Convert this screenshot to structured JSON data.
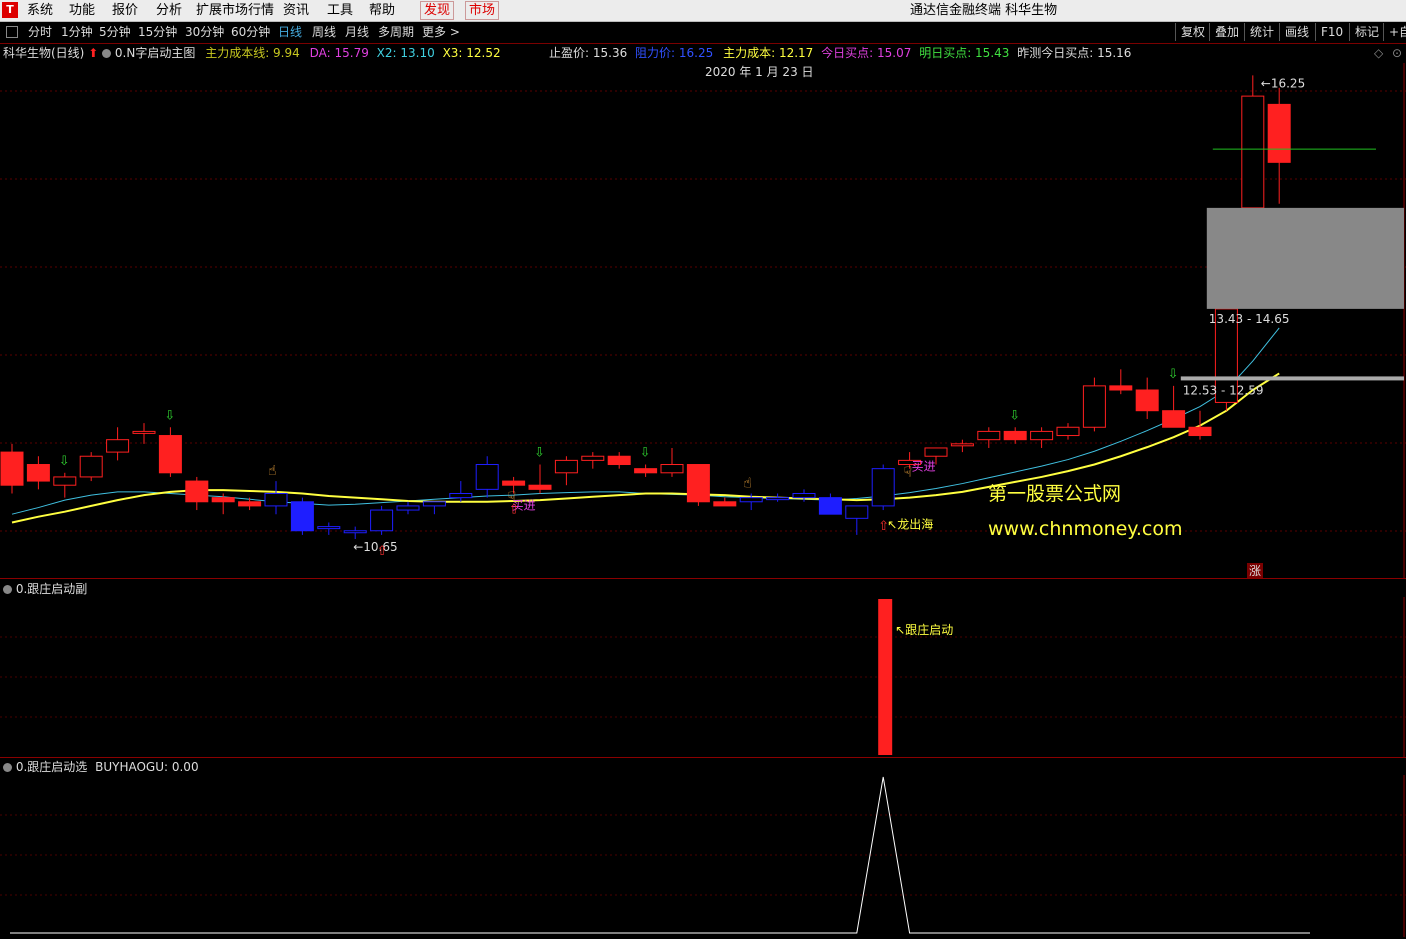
{
  "menubar": {
    "logo": "T",
    "items": [
      "系统",
      "功能",
      "报价",
      "分析",
      "扩展市场行情",
      "资讯",
      "工具",
      "帮助"
    ],
    "discover": "发现",
    "market": "市场",
    "title": "通达信金融终端  科华生物"
  },
  "periodbar": {
    "items": [
      "分时",
      "1分钟",
      "5分钟",
      "15分钟",
      "30分钟",
      "60分钟",
      "日线",
      "周线",
      "月线",
      "多周期",
      "更多 >"
    ],
    "active": "日线",
    "tools": [
      "复权",
      "叠加",
      "统计",
      "画线",
      "F10",
      "标记",
      "+自"
    ]
  },
  "main_pane": {
    "stock": "科华生物(日线)",
    "indicator": "0.N字启动主图",
    "stat1_label": "主力成本线: 9.94",
    "stat2_label": "DA: 15.79",
    "stat3_label": "X2: 13.10",
    "stat4_label": "X3: 12.52",
    "take_profit": "止盈价: 15.36",
    "resistance": "阻力价: 16.25",
    "main_cost": "主力成本: 12.17",
    "today_buy": "今日买点: 15.07",
    "tomorrow_buy": "明日买点: 15.43",
    "yesterday_buy": "昨测今日买点: 15.16",
    "date": "2020 年 1 月 23 日",
    "low_label": "←10.65",
    "high_label": "←16.25",
    "range1": "13.43 - 14.65",
    "range2": "12.53 - 12.59",
    "buy_text": "买进",
    "dragon_text": "↖龙出海",
    "watermark1": "第一股票公式网",
    "watermark2": "www.chnmoney.com",
    "zhang": "涨",
    "colors": {
      "up": "#ff2020",
      "down": "#1e1eff",
      "ma_yellow": "#ffff40",
      "ma_cyan": "#40c0e0",
      "text_yellow": "#ffff40"
    }
  },
  "sub_pane1": {
    "title": "0.跟庄启动副",
    "label": "↖跟庄启动"
  },
  "sub_pane2": {
    "title": "0.跟庄启动选",
    "value_label": "BUYHAOGU: 0.00"
  },
  "chart_data": [
    {
      "type": "candlestick",
      "ohlc": [
        [
          11.7,
          11.8,
          11.2,
          11.3
        ],
        [
          11.55,
          11.65,
          11.25,
          11.35
        ],
        [
          11.3,
          11.45,
          11.15,
          11.4
        ],
        [
          11.4,
          11.7,
          11.35,
          11.65
        ],
        [
          11.7,
          12.0,
          11.6,
          11.85
        ],
        [
          11.95,
          12.05,
          11.8,
          11.95
        ],
        [
          11.9,
          12.0,
          11.4,
          11.45
        ],
        [
          11.35,
          11.4,
          11.0,
          11.1
        ],
        [
          11.15,
          11.2,
          10.95,
          11.1
        ],
        [
          11.1,
          11.15,
          11.0,
          11.05
        ],
        [
          11.05,
          11.35,
          10.95,
          11.2
        ],
        [
          11.1,
          11.15,
          10.7,
          10.75
        ],
        [
          10.8,
          10.85,
          10.7,
          10.8
        ],
        [
          10.75,
          10.8,
          10.65,
          10.75
        ],
        [
          10.75,
          11.05,
          10.7,
          11.0
        ],
        [
          11.0,
          11.1,
          10.95,
          11.05
        ],
        [
          11.05,
          11.1,
          10.95,
          11.1
        ],
        [
          11.15,
          11.35,
          11.1,
          11.2
        ],
        [
          11.25,
          11.65,
          11.15,
          11.55
        ],
        [
          11.35,
          11.4,
          11.2,
          11.3
        ],
        [
          11.3,
          11.55,
          11.2,
          11.25
        ],
        [
          11.45,
          11.65,
          11.3,
          11.6
        ],
        [
          11.6,
          11.7,
          11.5,
          11.65
        ],
        [
          11.65,
          11.7,
          11.5,
          11.55
        ],
        [
          11.5,
          11.55,
          11.4,
          11.45
        ],
        [
          11.45,
          11.75,
          11.4,
          11.55
        ],
        [
          11.55,
          11.55,
          11.05,
          11.1
        ],
        [
          11.1,
          11.15,
          11.05,
          11.05
        ],
        [
          11.1,
          11.2,
          11.0,
          11.15
        ],
        [
          11.15,
          11.2,
          11.1,
          11.15
        ],
        [
          11.15,
          11.25,
          11.1,
          11.2
        ],
        [
          11.15,
          11.2,
          10.95,
          10.95
        ],
        [
          10.9,
          11.05,
          10.7,
          11.05
        ],
        [
          11.05,
          11.55,
          11.0,
          11.5
        ],
        [
          11.55,
          11.7,
          11.5,
          11.6
        ],
        [
          11.65,
          11.75,
          11.55,
          11.75
        ],
        [
          11.8,
          11.85,
          11.7,
          11.8
        ],
        [
          11.85,
          12.0,
          11.75,
          11.95
        ],
        [
          11.95,
          12.0,
          11.8,
          11.85
        ],
        [
          11.85,
          12.0,
          11.75,
          11.95
        ],
        [
          11.9,
          12.05,
          11.85,
          12.0
        ],
        [
          12.0,
          12.6,
          11.95,
          12.5
        ],
        [
          12.5,
          12.7,
          12.4,
          12.45
        ],
        [
          12.45,
          12.6,
          12.1,
          12.2
        ],
        [
          12.2,
          12.5,
          12.05,
          12.0
        ],
        [
          12.0,
          12.2,
          11.85,
          11.9
        ],
        [
          12.3,
          13.5,
          12.2,
          13.43
        ],
        [
          14.65,
          16.25,
          14.5,
          16.0
        ],
        [
          15.9,
          16.1,
          14.7,
          15.2
        ]
      ],
      "bar_colors": [
        "up",
        "up",
        "up",
        "up",
        "up",
        "up",
        "up",
        "up",
        "up",
        "up",
        "down",
        "down",
        "down",
        "down",
        "down",
        "down",
        "down",
        "down",
        "down",
        "up",
        "up",
        "up",
        "up",
        "up",
        "up",
        "up",
        "up",
        "up",
        "down",
        "down",
        "down",
        "down",
        "down",
        "down",
        "up",
        "up",
        "up",
        "up",
        "up",
        "up",
        "up",
        "up",
        "up",
        "up",
        "up",
        "up",
        "up",
        "up",
        "up"
      ],
      "ma_yellow": [
        10.85,
        10.92,
        10.98,
        11.05,
        11.12,
        11.18,
        11.22,
        11.24,
        11.24,
        11.23,
        11.22,
        11.2,
        11.17,
        11.15,
        11.13,
        11.11,
        11.1,
        11.1,
        11.1,
        11.11,
        11.12,
        11.14,
        11.16,
        11.18,
        11.2,
        11.2,
        11.19,
        11.18,
        11.16,
        11.15,
        11.14,
        11.13,
        11.12,
        11.13,
        11.15,
        11.18,
        11.22,
        11.28,
        11.34,
        11.4,
        11.47,
        11.55,
        11.65,
        11.76,
        11.88,
        12.02,
        12.2,
        12.45,
        12.65
      ],
      "ma_cyan": [
        10.95,
        11.03,
        11.12,
        11.18,
        11.22,
        11.22,
        11.2,
        11.18,
        11.16,
        11.13,
        11.1,
        11.08,
        11.06,
        11.07,
        11.09,
        11.11,
        11.13,
        11.15,
        11.17,
        11.18,
        11.2,
        11.21,
        11.22,
        11.22,
        11.2,
        11.19,
        11.18,
        11.16,
        11.15,
        11.14,
        11.13,
        11.12,
        11.14,
        11.17,
        11.21,
        11.26,
        11.32,
        11.39,
        11.46,
        11.53,
        11.61,
        11.71,
        11.83,
        11.96,
        12.1,
        12.25,
        12.45,
        12.8,
        13.2
      ],
      "ylim": [
        10.3,
        16.4
      ]
    },
    {
      "type": "bar",
      "title": "0.跟庄启动副",
      "index": 33,
      "value": 1
    },
    {
      "type": "line",
      "title": "0.跟庄启动选",
      "series": [
        {
          "name": "BUYHAOGU",
          "values": [
            0,
            0,
            0,
            0,
            0,
            0,
            0,
            0,
            0,
            0,
            0,
            0,
            0,
            0,
            0,
            0,
            0,
            0,
            0,
            0,
            0,
            0,
            0,
            0,
            0,
            0,
            0,
            0,
            0,
            0,
            0,
            0,
            0,
            1,
            0,
            0,
            0,
            0,
            0,
            0,
            0,
            0,
            0,
            0,
            0,
            0,
            0,
            0,
            0
          ]
        }
      ]
    }
  ]
}
